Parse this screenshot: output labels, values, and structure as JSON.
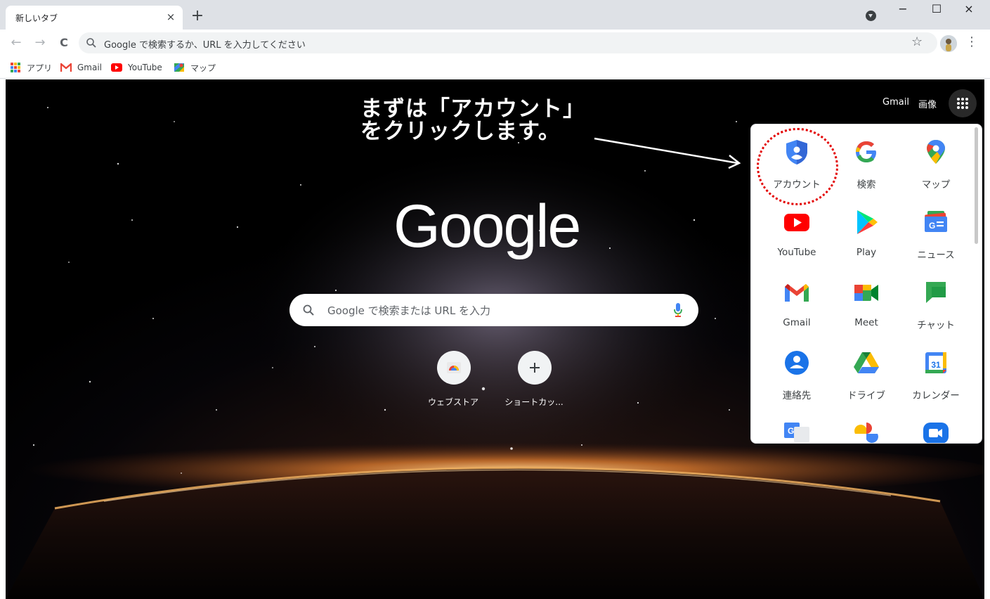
{
  "browser": {
    "tab_title": "新しいタブ",
    "tab_close": "×",
    "new_tab": "+",
    "window_buttons": {
      "minimize": "−",
      "maximize": "☐",
      "close": "×"
    },
    "nav": {
      "back": "←",
      "forward": "→",
      "reload": "C"
    },
    "omnibox_placeholder": "Google で検索するか、URL を入力してください",
    "star": "☆",
    "menu": "⋮"
  },
  "bookmarks": [
    {
      "label": "アプリ",
      "icon": "apps-grid-icon"
    },
    {
      "label": "Gmail",
      "icon": "gmail-icon"
    },
    {
      "label": "YouTube",
      "icon": "youtube-icon"
    },
    {
      "label": "マップ",
      "icon": "maps-icon"
    }
  ],
  "newtab": {
    "gmail_link": "Gmail",
    "images_link": "画像",
    "logo": "Google",
    "search_placeholder": "Google で検索または URL を入力",
    "shortcuts": [
      {
        "label": "ウェブストア",
        "icon": "webstore-icon"
      },
      {
        "label": "ショートカッ...",
        "icon": "plus-icon"
      }
    ]
  },
  "annotation": {
    "line1": "まずは「アカウント」",
    "line2": "をクリックします。"
  },
  "apps_panel": {
    "apps": [
      {
        "label": "アカウント",
        "icon": "account-shield-icon"
      },
      {
        "label": "検索",
        "icon": "google-g-icon"
      },
      {
        "label": "マップ",
        "icon": "maps-pin-icon"
      },
      {
        "label": "YouTube",
        "icon": "youtube-icon"
      },
      {
        "label": "Play",
        "icon": "play-triangle-icon"
      },
      {
        "label": "ニュース",
        "icon": "news-icon"
      },
      {
        "label": "Gmail",
        "icon": "gmail-icon"
      },
      {
        "label": "Meet",
        "icon": "meet-icon"
      },
      {
        "label": "チャット",
        "icon": "chat-icon"
      },
      {
        "label": "連絡先",
        "icon": "contacts-icon"
      },
      {
        "label": "ドライブ",
        "icon": "drive-icon"
      },
      {
        "label": "カレンダー",
        "icon": "calendar-icon"
      }
    ],
    "calendar_day": "31"
  },
  "colors": {
    "google_blue": "#4285f4",
    "google_red": "#ea4335",
    "google_yellow": "#fbbc04",
    "google_green": "#34a853",
    "annotation_red": "#e30000"
  }
}
